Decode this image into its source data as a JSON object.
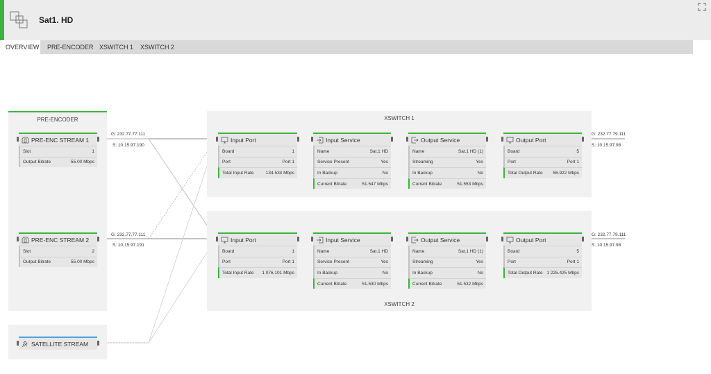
{
  "header": {
    "title": "Sat1. HD"
  },
  "tabs": [
    {
      "label": "OVERVIEW",
      "active": true
    },
    {
      "label": "PRE-ENCODER"
    },
    {
      "label": "XSWITCH 1"
    },
    {
      "label": "XSWITCH 2"
    }
  ],
  "pre_encoder": {
    "title": "PRE-ENCODER",
    "streams": [
      {
        "title": "PRE-ENC STREAM 1",
        "slot_label": "Slot",
        "slot": "1",
        "bitrate_label": "Output Bitrate",
        "bitrate": "55.00 Mbps",
        "g": "G: 232.77.77.111",
        "s": "S: 10.15.97.190"
      },
      {
        "title": "PRE-ENC STREAM 2",
        "slot_label": "Slot",
        "slot": "2",
        "bitrate_label": "Output Bitrate",
        "bitrate": "55.00 Mbps",
        "g": "G: 232.77.77.111",
        "s": "S: 10.15.97.191"
      }
    ]
  },
  "satellite": {
    "title": "SATELLITE STREAM"
  },
  "xswitches": [
    {
      "title": "XSWITCH 1",
      "input_port": {
        "title": "Input Port",
        "rows": [
          [
            "Board",
            "1"
          ],
          [
            "Port",
            "Port 1"
          ],
          [
            "Total Input Rate",
            "134.534 Mbps"
          ]
        ]
      },
      "input_service": {
        "title": "Input Service",
        "rows": [
          [
            "Name",
            "Sat.1 HD"
          ],
          [
            "Service Present",
            "Yes"
          ],
          [
            "In Backup",
            "No"
          ],
          [
            "Current Bitrate",
            "51.547 Mbps"
          ]
        ]
      },
      "output_service": {
        "title": "Output Service",
        "rows": [
          [
            "Name",
            "Sat.1 HD (1)"
          ],
          [
            "Streaming",
            "Yes"
          ],
          [
            "In Backup",
            "No"
          ],
          [
            "Current Bitrate",
            "51.553 Mbps"
          ]
        ]
      },
      "output_port": {
        "title": "Output Port",
        "rows": [
          [
            "Board",
            "5"
          ],
          [
            "Port",
            "Port 1"
          ],
          [
            "Total Output Rate",
            "56.922 Mbps"
          ]
        ]
      },
      "g": "G: 232.77.79.111",
      "s": "S: 10.15.97.98"
    },
    {
      "title": "XSWITCH 2",
      "input_port": {
        "title": "Input Port",
        "rows": [
          [
            "Board",
            "1"
          ],
          [
            "Port",
            "Port 1"
          ],
          [
            "Total Input Rate",
            "1 076.101 Mbps"
          ]
        ]
      },
      "input_service": {
        "title": "Input Service",
        "rows": [
          [
            "Name",
            "Sat.1 HD"
          ],
          [
            "Service Present",
            "Yes"
          ],
          [
            "In Backup",
            "No"
          ],
          [
            "Current Bitrate",
            "51.530 Mbps"
          ]
        ]
      },
      "output_service": {
        "title": "Output Service",
        "rows": [
          [
            "Name",
            "Sat.1 HD (1)"
          ],
          [
            "Streaming",
            "Yes"
          ],
          [
            "In Backup",
            "No"
          ],
          [
            "Current Bitrate",
            "51.532 Mbps"
          ]
        ]
      },
      "output_port": {
        "title": "Output Port",
        "rows": [
          [
            "Board",
            "5"
          ],
          [
            "Port",
            "Port 1"
          ],
          [
            "Total Output Rate",
            "1 225.425 Mbps"
          ]
        ]
      },
      "g": "G: 232.77.79.111",
      "s": "S: 10.15.97.98"
    }
  ],
  "colors": {
    "accent": "#3cb43c",
    "satellite_accent": "#4aa3df"
  }
}
